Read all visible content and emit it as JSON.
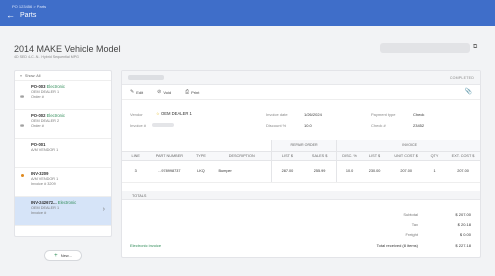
{
  "header": {
    "breadcrumb": "PO 123456 > Parts",
    "title": "Parts"
  },
  "vehicle": {
    "title": "2014 MAKE Vehicle Model",
    "subtitle": "4D SED 4-C..N.. Hybrid Sequential MPG"
  },
  "list": {
    "show_all": "Show: All",
    "items": [
      {
        "title": "PO-003",
        "status": "Electronic",
        "line1": "OEM DEALER 1",
        "line2": "Order #",
        "icon": "truck-icon"
      },
      {
        "title": "PO-002",
        "status": "Electronic",
        "line1": "OEM DEALER 2",
        "line2": "Order #",
        "icon": "truck-icon"
      },
      {
        "title": "PO-001",
        "status": "",
        "line1": "A/M VENDOR 1",
        "line2": "",
        "icon": ""
      },
      {
        "title": "INV-3209",
        "status": "",
        "line1": "A/M VENDOR 1",
        "line2": "Invoice # 3209",
        "icon": "dot"
      },
      {
        "title": "INV-242672...",
        "status": "Electronic",
        "line1": "OEM DEALER 1",
        "line2": "Invoice #",
        "icon": ""
      }
    ],
    "new_button": "New..."
  },
  "detail": {
    "status": "COMPLETED",
    "actions": {
      "edit": "Edit",
      "void": "Void",
      "print": "Print"
    },
    "vendor_label": "Vendor",
    "vendor_value": "OEM DEALER 1",
    "invoice_label": "Invoice #",
    "invoice_date_label": "Invoice date",
    "invoice_date_value": "1/26/2024",
    "discount_label": "Discount %",
    "discount_value": "10.0",
    "payment_type_label": "Payment type",
    "payment_type_value": "Check",
    "check_label": "Check #",
    "check_value": "23452",
    "group_headers": {
      "repair_order": "REPAIR ORDER",
      "invoice": "INVOICE"
    },
    "columns": [
      "LINE",
      "PART NUMBER",
      "TYPE",
      "DESCRIPTION",
      "LIST $",
      "SALES $",
      "DISC. %",
      "LIST $",
      "UNIT COST $",
      "QTY",
      "EXT. COST $"
    ],
    "rows": [
      {
        "line": "3",
        "part_number": "...978998737",
        "type": "LKQ",
        "description": "Bumper",
        "list_ro": "287.00",
        "sales": "255.99",
        "disc": "10.0",
        "list_inv": "230.00",
        "unit_cost": "207.00",
        "qty": "1",
        "ext_cost": "207.00"
      }
    ],
    "totals_label": "TOTALS",
    "subtotal_label": "Subtotal",
    "subtotal_value": "$ 207.00",
    "tax_label": "Tax",
    "tax_value": "$ 20.18",
    "freight_label": "Freight",
    "freight_value": "$ 0.00",
    "total_label": "Total received (8 items)",
    "total_value": "$ 227.18",
    "electronic_invoice": "Electronic invoice"
  },
  "colors": {
    "topbar": "#3f6ec9",
    "electronic": "#2e8b57",
    "selected": "#d6e4f8",
    "dot": "#e08a1f"
  }
}
